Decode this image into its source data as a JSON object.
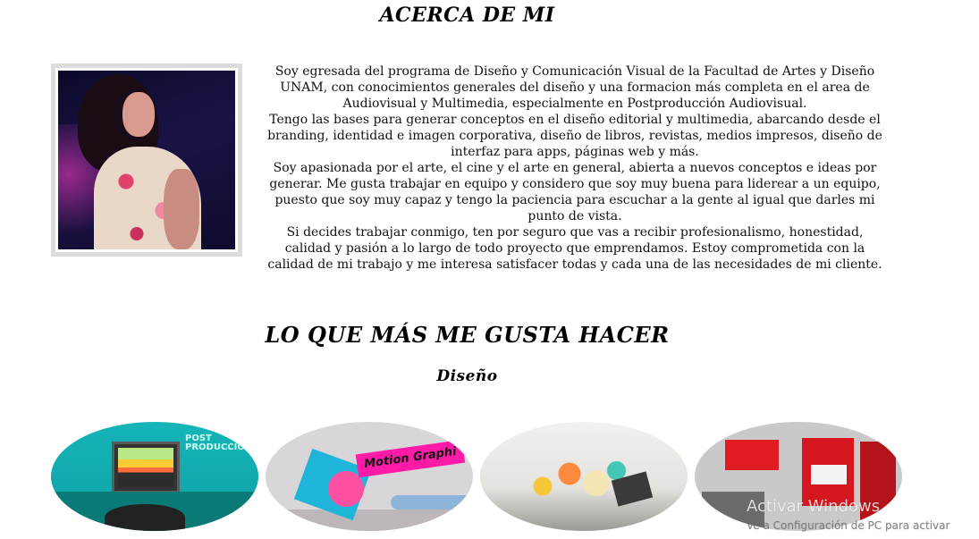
{
  "about": {
    "title": "ACERCA DE MI",
    "paragraphs": [
      "Soy egresada del programa de Diseño y Comunicación Visual de la Facultad de Artes y Diseño UNAM, con conocimientos generales del diseño y una formacion más completa en el area de Audiovisual y Multimedia, especialmente en Postproducción Audiovisual.",
      "Tengo las bases para generar conceptos en el diseño editorial y multimedia, abarcando desde el branding, identidad e imagen corporativa, diseño de libros, revistas, medios impresos, diseño de interfaz para apps, páginas web y más.",
      "Soy apasionada por el arte, el cine y el arte en general, abierta a nuevos conceptos e ideas por generar. Me gusta trabajar en equipo y considero que soy muy buena para liderear a un equipo, puesto que soy muy capaz y tengo la paciencia para escuchar a la gente al igual que darles mi punto de vista.",
      "Si decides trabajar conmigo, ten por seguro que vas a recibir profesionalismo, honestidad, calidad y pasión a lo largo de todo proyecto que emprendamos. Estoy comprometida con la calidad de mi trabajo y me interesa satisfacer todas y cada una de las necesidades de mi cliente."
    ]
  },
  "love": {
    "title": "LO QUE MÁS ME GUSTA HACER",
    "subtitle": "Diseño"
  },
  "gallery": {
    "c1_text": "POST PRODUCCIO",
    "c2_text": "Motion Graphi"
  },
  "watermark": {
    "line1": "Activar Windows",
    "line2": "Ve a Configuración de PC para activar"
  }
}
